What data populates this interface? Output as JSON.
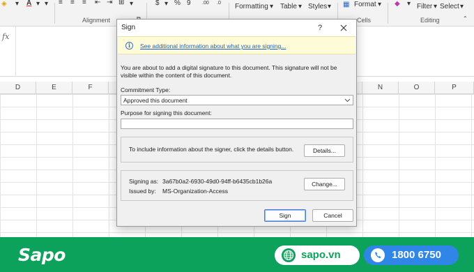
{
  "ribbon": {
    "conditional_formatting": "Formatting",
    "format_as_table": "Table",
    "cell_styles": "Styles",
    "format": "Format",
    "filter": "Filter",
    "select": "Select",
    "group_alignment": "Alignment",
    "group_cells": "Cells",
    "group_editing": "Editing",
    "currency_symbol": "$",
    "percent_symbol": "%",
    "comma_symbol": "9",
    "decimal_increase": ".00",
    "decimal_decrease": ".0"
  },
  "formula_bar": {
    "fx_label": "fx"
  },
  "columns": [
    "D",
    "E",
    "F",
    "",
    "",
    "",
    "",
    "",
    "",
    "",
    "N",
    "O",
    "P"
  ],
  "dialog": {
    "title": "Sign",
    "help_label": "?",
    "info_link": "See additional information about what you are signing...",
    "description": "You are about to add a digital signature to this document. This signature will not be visible within the content of this document.",
    "commitment_label": "Commitment Type:",
    "commitment_value": "Approved this document",
    "purpose_label": "Purpose for signing this document:",
    "purpose_value": "",
    "details_text": "To include information about the signer, click the details button.",
    "details_button": "Details...",
    "signing_as_label": "Signing as:",
    "signing_as_value": "3a67b0a2-6930-49d0-94ff-b6435cb1b26a",
    "issued_by_label": "Issued by:",
    "issued_by_value": "MS-Organization-Access",
    "change_button": "Change...",
    "sign_button": "Sign",
    "cancel_button": "Cancel"
  },
  "footer": {
    "logo": "Sapo",
    "website": "sapo.vn",
    "phone": "1800 6750",
    "brand_color": "#0ca25b",
    "phone_color": "#2f86e6"
  }
}
